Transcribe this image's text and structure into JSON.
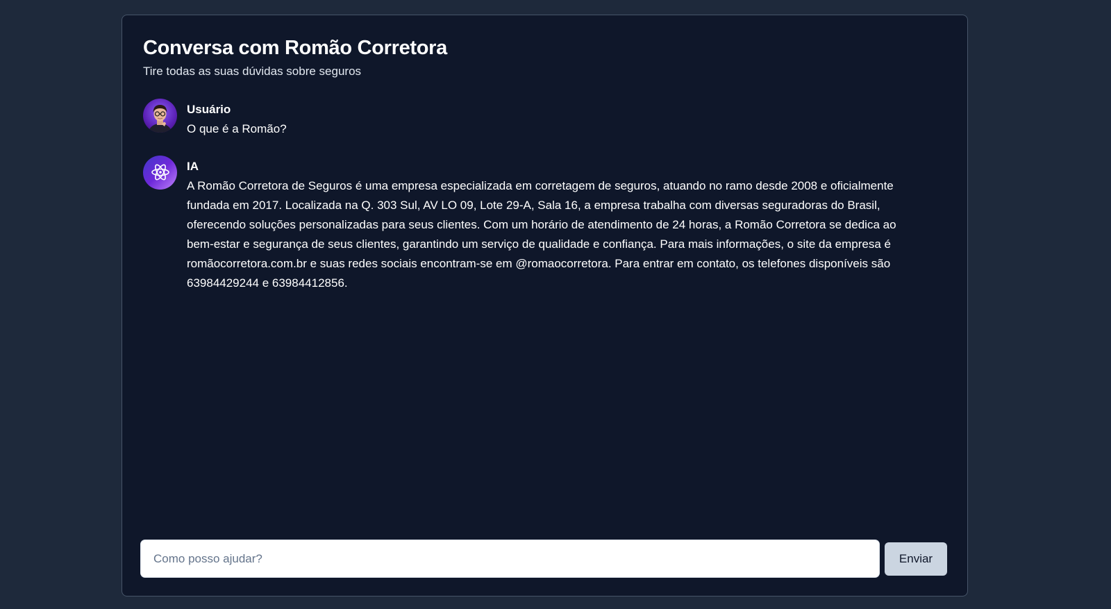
{
  "header": {
    "title": "Conversa com Romão Corretora",
    "subtitle": "Tire todas as suas dúvidas sobre seguros"
  },
  "messages": [
    {
      "author": "Usuário",
      "avatar_icon": "user-photo-avatar",
      "text": "O que é a Romão?"
    },
    {
      "author": "IA",
      "avatar_icon": "atom-icon",
      "text": "A Romão Corretora de Seguros é uma empresa especializada em corretagem de seguros, atuando no ramo desde 2008 e oficialmente fundada em 2017. Localizada na Q. 303 Sul, AV LO 09, Lote 29-A, Sala 16, a empresa trabalha com diversas seguradoras do Brasil, oferecendo soluções personalizadas para seus clientes. Com um horário de atendimento de 24 horas, a Romão Corretora se dedica ao bem-estar e segurança de seus clientes, garantindo um serviço de qualidade e confiança. Para mais informações, o site da empresa é romãocorretora.com.br e suas redes sociais encontram-se em @romaocorretora. Para entrar em contato, os telefones disponíveis são 63984429244 e 63984412856."
    }
  ],
  "composer": {
    "placeholder": "Como posso ajudar?",
    "value": "",
    "send_label": "Enviar"
  },
  "colors": {
    "page_background": "#1e293b",
    "card_background": "#0f172a",
    "send_button": "#cbd5e1"
  }
}
